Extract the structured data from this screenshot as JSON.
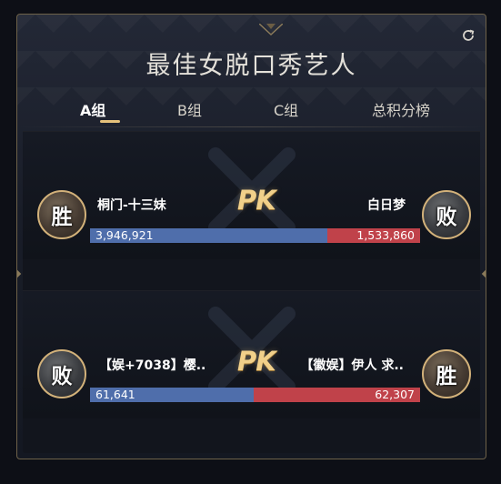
{
  "panel": {
    "title": "最佳女脱口秀艺人",
    "refresh_icon": "refresh-icon"
  },
  "tabs": [
    {
      "label": "A组",
      "active": true
    },
    {
      "label": "B组",
      "active": false
    },
    {
      "label": "C组",
      "active": false
    },
    {
      "label": "总积分榜",
      "active": false
    }
  ],
  "pk_label": "PK",
  "matchups": [
    {
      "left": {
        "name": "桐门-十三妹",
        "result": "胜",
        "score": "3,946,921",
        "score_value": 3946921
      },
      "right": {
        "name": "白日梦",
        "result": "败",
        "score": "1,533,860",
        "score_value": 1533860
      },
      "left_share": 0.72
    },
    {
      "left": {
        "name": "【娱+7038】樱..",
        "result": "败",
        "score": "61,641",
        "score_value": 61641
      },
      "right": {
        "name": "【徽娱】伊人 求..",
        "result": "胜",
        "score": "62,307",
        "score_value": 62307
      },
      "left_share": 0.497
    }
  ],
  "colors": {
    "accent_gold": "#e6c27b",
    "left_bar": "#4f6eab",
    "right_bar": "#c0424a"
  }
}
